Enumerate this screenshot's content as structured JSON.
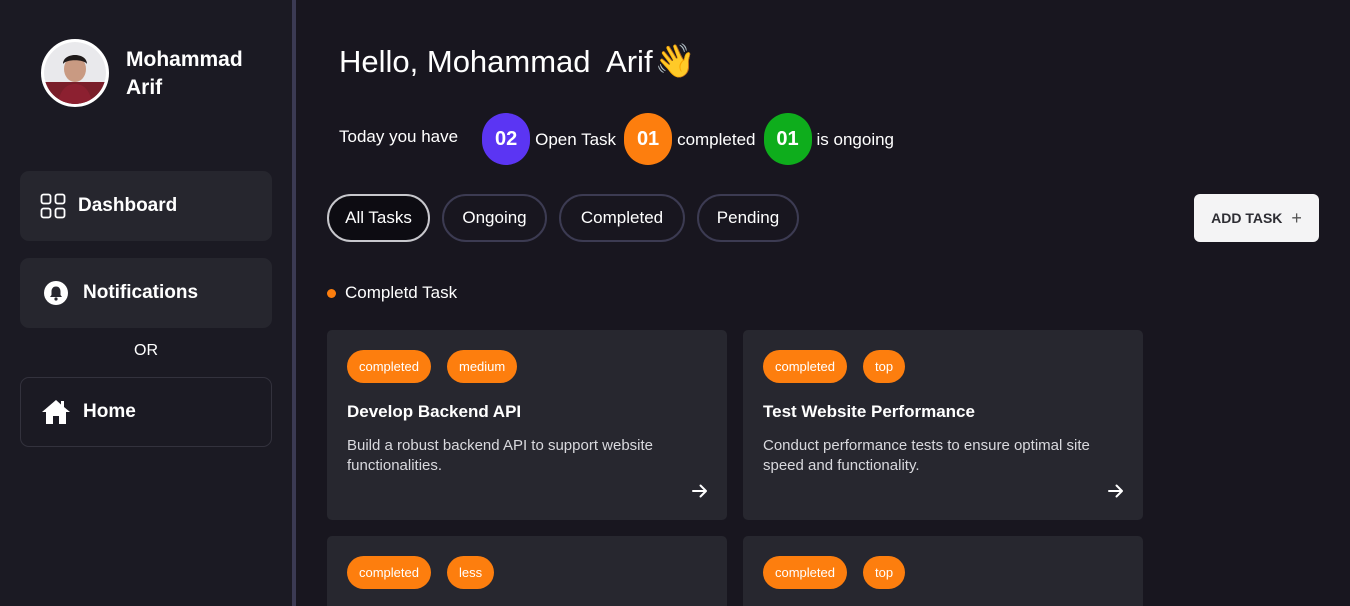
{
  "user": {
    "name": "Mohammad Arif"
  },
  "sidebar": {
    "items": [
      {
        "label": "Dashboard",
        "icon": "grid-icon"
      },
      {
        "label": "Notifications",
        "icon": "bell-icon"
      },
      {
        "label": "Home",
        "icon": "home-icon"
      }
    ],
    "separator": "OR"
  },
  "header": {
    "greeting": "Hello, Mohammad  Arif",
    "wave": "👋"
  },
  "summary": {
    "lead": "Today you have",
    "stats": [
      {
        "count": "02",
        "label": "Open Task",
        "color": "#5b35f3"
      },
      {
        "count": "01",
        "label": "completed",
        "color": "#fd7e0e"
      },
      {
        "count": "01",
        "label": "is ongoing",
        "color": "#0ead1c"
      }
    ]
  },
  "filters": {
    "items": [
      "All Tasks",
      "Ongoing",
      "Completed",
      "Pending"
    ],
    "active": "All Tasks"
  },
  "add_task": {
    "label": "ADD TASK",
    "icon": "plus-icon"
  },
  "section": {
    "title": "Completd Task",
    "dot_color": "#fd7e0e"
  },
  "cards": [
    {
      "status": "completed",
      "priority": "medium",
      "title": "Develop Backend API",
      "description": "Build a robust backend API to support website functionalities."
    },
    {
      "status": "completed",
      "priority": "top",
      "title": "Test Website Performance",
      "description": "Conduct performance tests to ensure optimal site speed and functionality."
    },
    {
      "status": "completed",
      "priority": "less"
    },
    {
      "status": "completed",
      "priority": "top"
    }
  ],
  "colors": {
    "background": "#18161f",
    "sidebar": "#1b1a23",
    "card": "#27272f",
    "accent_orange": "#fd7e0e"
  }
}
